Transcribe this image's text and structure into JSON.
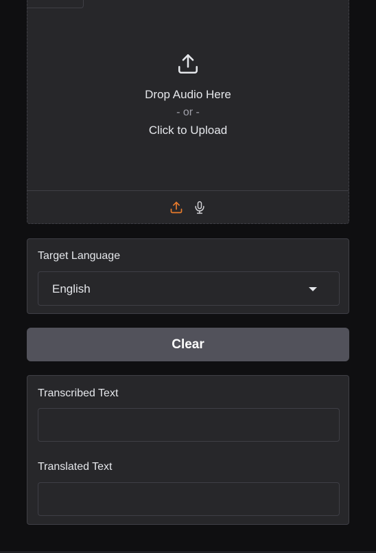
{
  "audio_input": {
    "drop_text": "Drop Audio Here",
    "or_text": "- or -",
    "click_text": "Click to Upload",
    "sources": [
      {
        "name": "upload",
        "icon": "upload-icon",
        "active": true
      },
      {
        "name": "microphone",
        "icon": "microphone-icon",
        "active": false
      }
    ]
  },
  "target_language": {
    "label": "Target Language",
    "selected": "English"
  },
  "clear_button": {
    "label": "Clear"
  },
  "outputs": {
    "transcribed_label": "Transcribed Text",
    "transcribed_value": "",
    "translated_label": "Translated Text",
    "translated_value": ""
  },
  "colors": {
    "background": "#0f0f11",
    "panel": "#27272a",
    "border": "#3f3f46",
    "accent": "#ea7c2c",
    "button": "#52525b"
  }
}
